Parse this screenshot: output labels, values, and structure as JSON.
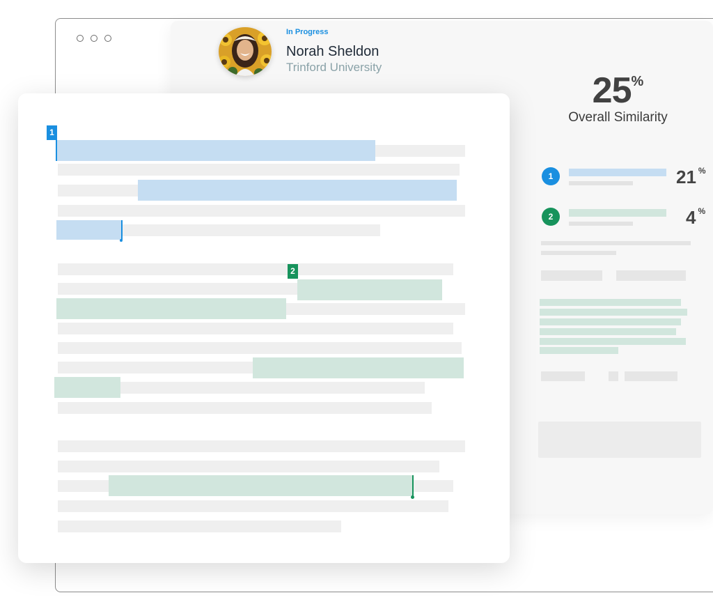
{
  "submission": {
    "status": "In Progress",
    "student_name": "Norah Sheldon",
    "institution": "Trinford University"
  },
  "similarity": {
    "overall_value": "25",
    "overall_unit": "%",
    "overall_label": "Overall Similarity",
    "sources": [
      {
        "number": "1",
        "percent": "21",
        "unit": "%",
        "color": "#1a8fe0"
      },
      {
        "number": "2",
        "percent": "4",
        "unit": "%",
        "color": "#17935c"
      }
    ]
  },
  "document": {
    "markers": [
      {
        "number": "1",
        "color": "#1a8fe0"
      },
      {
        "number": "2",
        "color": "#17935c"
      }
    ]
  }
}
